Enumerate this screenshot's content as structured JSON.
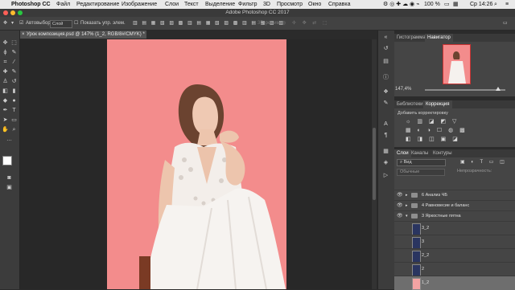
{
  "menubar": {
    "app": "Photoshop CC",
    "items": [
      "Файл",
      "Редактирование",
      "Изображение",
      "Слои",
      "Текст",
      "Выделение",
      "Фильтр",
      "3D",
      "Просмотр",
      "Окно",
      "Справка"
    ],
    "battery": "100 %",
    "clock": "Ср 14:26"
  },
  "window_title": "Adobe Photoshop CC 2017",
  "options": {
    "autoselect_label": "Автовыбор:",
    "autoselect_value": "Слой",
    "show_controls_label": "Показать упр. элем.",
    "mode_3d": "3D-режим:"
  },
  "document_tab": "Урок композиция.psd @ 147% (1_2, RGB/8#/CMYK) *",
  "panels": {
    "navigator_tabs": [
      "Гистограмма",
      "Навигатор"
    ],
    "zoom": "147,4%",
    "adjust_tabs": [
      "Библиотеки",
      "Коррекция"
    ],
    "adjust_title": "Добавить корректировку",
    "layers_tabs": [
      "Слои",
      "Каналы",
      "Контуры"
    ],
    "layer_filter": "Вид",
    "blend_mode": "Обычные",
    "opacity_label": "Непрозрачность:",
    "layers": [
      {
        "name": "6 Анализ ЧБ",
        "kind": "group",
        "visible": true
      },
      {
        "name": "4 Равновесие и баланс",
        "kind": "group",
        "visible": true
      },
      {
        "name": "3 Яркостные пятна",
        "kind": "group",
        "visible": true,
        "open": true
      },
      {
        "name": "3_2",
        "kind": "layer"
      },
      {
        "name": "3",
        "kind": "layer"
      },
      {
        "name": "2_2",
        "kind": "layer"
      },
      {
        "name": "2",
        "kind": "layer"
      },
      {
        "name": "1_2",
        "kind": "layer",
        "selected": true
      }
    ]
  },
  "colors": {
    "canvas_bg": "#f38c8c",
    "ui_dark": "#2b2b2b",
    "panel": "#454545"
  }
}
